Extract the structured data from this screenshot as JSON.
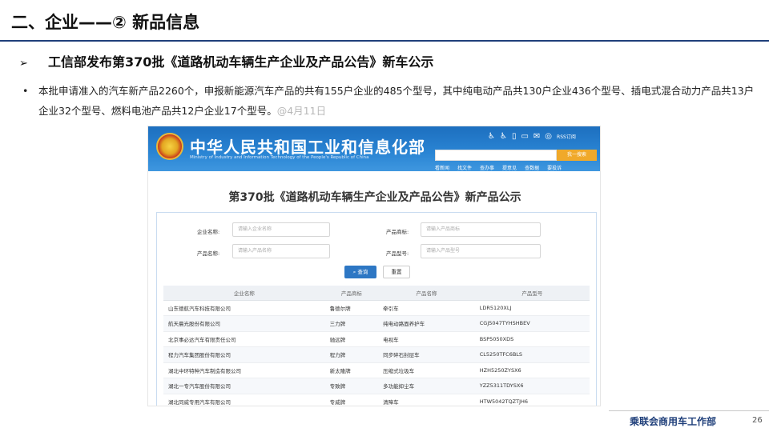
{
  "slide": {
    "title": "二、企业——② 新品信息",
    "subtitle": "工信部发布第370批《道路机动车辆生产企业及产品公告》新车公示",
    "bullet_symbol": "•",
    "bullet_text": "本批申请准入的汽车新产品2260个，申报新能源汽车产品的共有155户企业的485个型号，其中纯电动产品共130户企业436个型号、插电式混合动力产品共13户企业32个型号、燃料电池产品共12户企业17个型号。",
    "bullet_source": "@4月11日",
    "footer": "乘联会商用车工作部",
    "page_number": "26"
  },
  "website": {
    "title": "中华人民共和国工业和信息化部",
    "subtitle_en": "Ministry of Industry and Information Technology of the People's Republic of China",
    "top_icons": [
      "accessibility-icon",
      "wheelchair-icon",
      "mobile-icon",
      "message-icon",
      "mail-icon",
      "weibo-icon"
    ],
    "rss_label": "RSS订阅",
    "search_button": "我一搜索",
    "nav": [
      "看新闻",
      "找文件",
      "查办事",
      "提意见",
      "查数据",
      "要投诉"
    ],
    "heading": "第370批《道路机动车辆生产企业及产品公告》新产品公示",
    "form": {
      "company_label": "企业名称:",
      "company_placeholder": "请输入企业名称",
      "brand_label": "产品商标:",
      "brand_placeholder": "请输入产品商标",
      "product_label": "产品名称:",
      "product_placeholder": "请输入产品名称",
      "model_label": "产品型号:",
      "model_placeholder": "请输入产品型号",
      "query_button": "查询",
      "reset_button": "重置"
    },
    "table": {
      "headers": [
        "企业名称",
        "产品商标",
        "产品名称",
        "产品型号"
      ],
      "rows": [
        [
          "山东德航汽车科技有限公司",
          "鲁德尔牌",
          "牵引车",
          "LDR5120XLJ"
        ],
        [
          "航天晨光股份有限公司",
          "三力牌",
          "纯电动路面养护车",
          "CGJ5047TYHSHBEV"
        ],
        [
          "北京事必达汽车有限责任公司",
          "驰远牌",
          "电视车",
          "BSP5050XDS"
        ],
        [
          "程力汽车集团股份有限公司",
          "程力牌",
          "同步碎石封层车",
          "CL5250TFC6BLS"
        ],
        [
          "湖北中环特种汽车制造有限公司",
          "新太隆牌",
          "压缩式垃圾车",
          "HZH5250ZYSX6"
        ],
        [
          "湖北一专汽车股份有限公司",
          "专致牌",
          "多功能抑尘车",
          "YZZ5311TDYSX6"
        ],
        [
          "湖北同威专用汽车有限公司",
          "专威牌",
          "清障车",
          "HTW5042TQZTJH6"
        ]
      ]
    }
  },
  "colors": {
    "header_rule": "#1f3f7a",
    "banner_blue": "#2a85d4",
    "search_orange": "#f0a92a",
    "query_blue": "#2d77c4"
  }
}
